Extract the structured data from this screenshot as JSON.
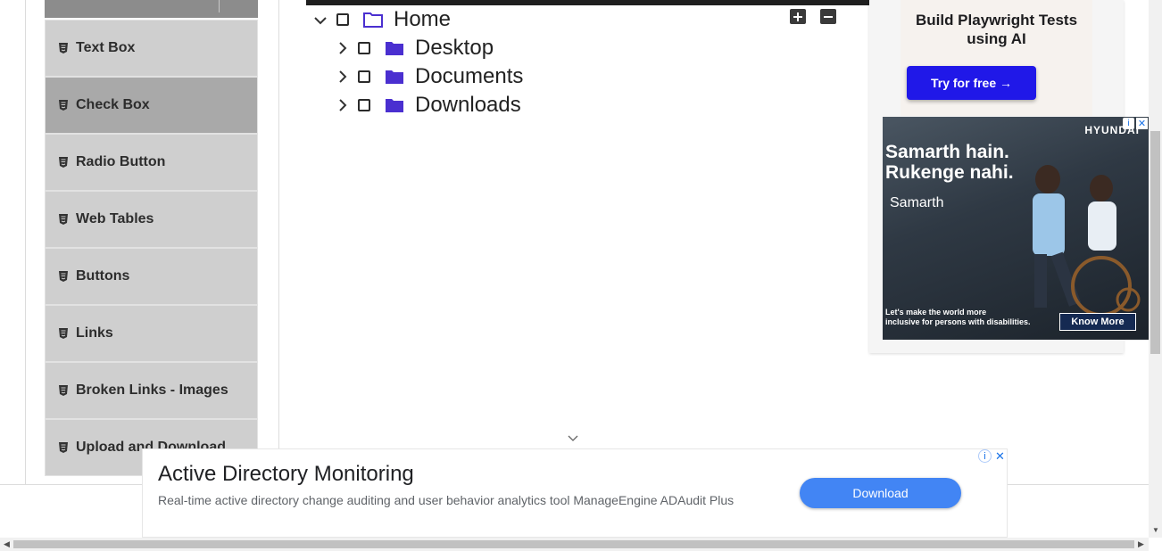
{
  "sidebar": {
    "items": [
      {
        "label": "Text Box",
        "active": false
      },
      {
        "label": "Check Box",
        "active": true
      },
      {
        "label": "Radio Button",
        "active": false
      },
      {
        "label": "Web Tables",
        "active": false
      },
      {
        "label": "Buttons",
        "active": false
      },
      {
        "label": "Links",
        "active": false
      },
      {
        "label": "Broken Links - Images",
        "active": false
      },
      {
        "label": "Upload and Download",
        "active": false
      }
    ]
  },
  "tree": {
    "expand_all_icon": "plus-square-icon",
    "collapse_all_icon": "minus-square-icon",
    "nodes": [
      {
        "label": "Home",
        "expanded": true,
        "checked": false,
        "level": 0,
        "icon": "folder-open-icon"
      },
      {
        "label": "Desktop",
        "expanded": false,
        "checked": false,
        "level": 1,
        "icon": "folder-icon"
      },
      {
        "label": "Documents",
        "expanded": false,
        "checked": false,
        "level": 1,
        "icon": "folder-icon"
      },
      {
        "label": "Downloads",
        "expanded": false,
        "checked": false,
        "level": 1,
        "icon": "folder-icon"
      }
    ]
  },
  "right_ad": {
    "playwright": {
      "title": "Build Playwright Tests using AI",
      "button": "Try for free →"
    },
    "hyundai": {
      "brand": "HYUNDAI",
      "headline_line1": "Samarth hain.",
      "headline_line2": "Rukenge nahi.",
      "sub_brand": "Samarth",
      "sub_line1": "Let's make the world more",
      "sub_line2": "inclusive for persons with disabilities.",
      "cta": "Know More"
    }
  },
  "bottom_ad": {
    "title": "Active Directory Monitoring",
    "description": "Real-time active directory change auditing and user behavior analytics tool ManageEngine ADAudit Plus",
    "button": "Download"
  },
  "colors": {
    "sidebar_item_bg": "#cfcfcf",
    "sidebar_active_bg": "#a9a9a9",
    "folder_color": "#4a2fd0",
    "playwright_button": "#2018e8",
    "download_button": "#4285f4"
  }
}
